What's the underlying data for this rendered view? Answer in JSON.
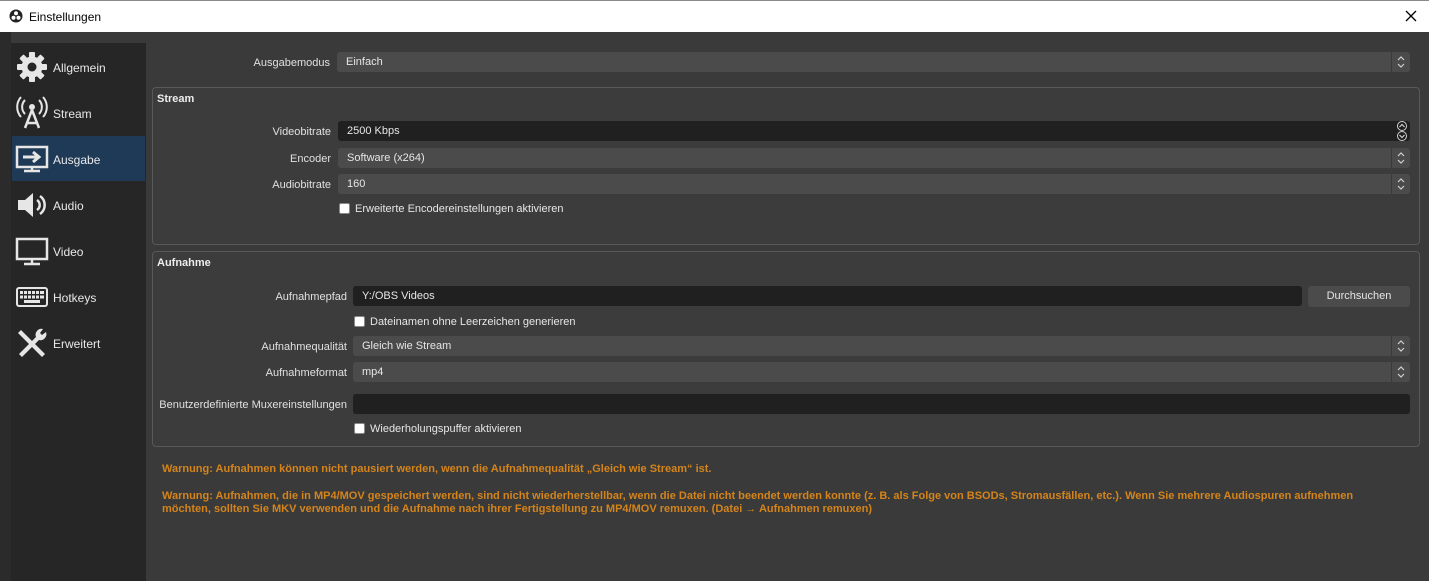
{
  "window": {
    "title": "Einstellungen"
  },
  "sidebar": {
    "items": [
      {
        "label": "Allgemein",
        "icon": "gear-icon"
      },
      {
        "label": "Stream",
        "icon": "broadcast-antenna-icon"
      },
      {
        "label": "Ausgabe",
        "icon": "output-monitor-icon",
        "active": true
      },
      {
        "label": "Audio",
        "icon": "speaker-icon"
      },
      {
        "label": "Video",
        "icon": "monitor-icon"
      },
      {
        "label": "Hotkeys",
        "icon": "keyboard-icon"
      },
      {
        "label": "Erweitert",
        "icon": "tools-icon"
      }
    ]
  },
  "output": {
    "mode_label": "Ausgabemodus",
    "mode_value": "Einfach",
    "stream": {
      "title": "Stream",
      "videobitrate_label": "Videobitrate",
      "videobitrate_value": "2500 Kbps",
      "encoder_label": "Encoder",
      "encoder_value": "Software (x264)",
      "audiobitrate_label": "Audiobitrate",
      "audiobitrate_value": "160",
      "advanced_encoder_label": "Erweiterte Encodereinstellungen aktivieren"
    },
    "recording": {
      "title": "Aufnahme",
      "path_label": "Aufnahmepfad",
      "path_value": "Y:/OBS Videos",
      "browse_label": "Durchsuchen",
      "no_spaces_label": "Dateinamen ohne Leerzeichen generieren",
      "quality_label": "Aufnahmequalität",
      "quality_value": "Gleich wie Stream",
      "format_label": "Aufnahmeformat",
      "format_value": "mp4",
      "muxer_label": "Benutzerdefinierte Muxereinstellungen",
      "muxer_value": "",
      "replay_buffer_label": "Wiederholungspuffer aktivieren"
    },
    "warnings": [
      "Warnung: Aufnahmen können nicht pausiert werden, wenn die Aufnahmequalität „Gleich wie Stream“ ist.",
      "Warnung: Aufnahmen, die in MP4/MOV gespeichert werden, sind nicht wiederherstellbar, wenn die Datei nicht beendet werden konnte (z. B. als Folge von BSODs, Stromausfällen, etc.). Wenn Sie mehrere Audiospuren aufnehmen möchten, sollten Sie MKV verwenden und die Aufnahme nach ihrer Fertigstellung zu MP4/MOV remuxen. (Datei → Aufnahmen remuxen)"
    ]
  },
  "colors": {
    "warning": "#d4841a",
    "active_sidebar": "#1e3a56",
    "background": "#3a3a3a"
  }
}
